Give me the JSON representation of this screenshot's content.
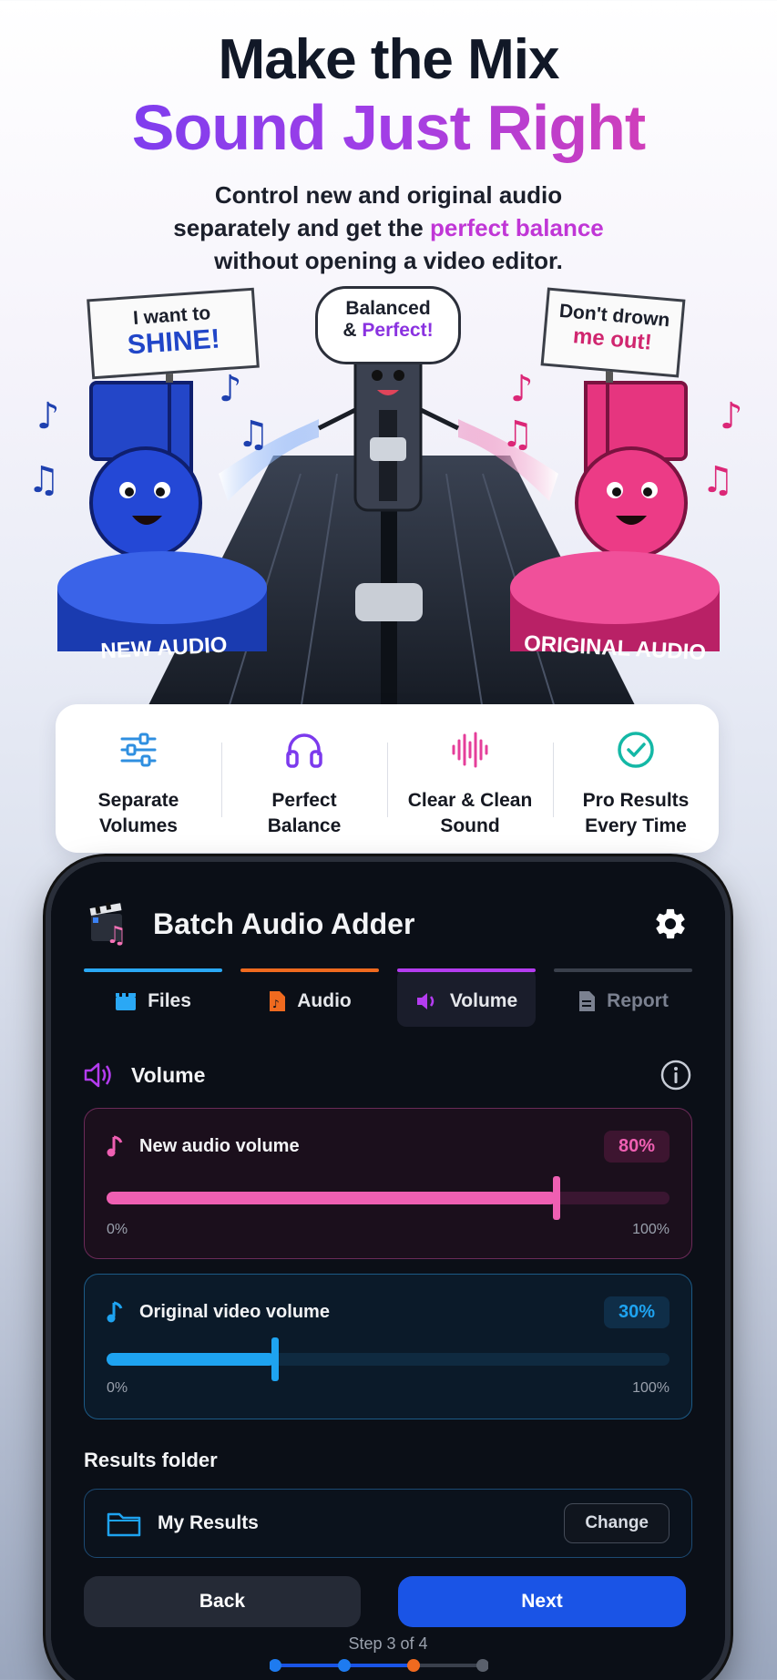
{
  "hero": {
    "headline_line1": "Make the Mix",
    "headline_line2": "Sound Just Right",
    "sub_line1": "Control new and original audio",
    "sub_line2_pre": "separately and get the ",
    "sub_line2_accent": "perfect balance",
    "sub_line3": "without opening a video editor.",
    "left_sign_line1": "I want to",
    "left_sign_line2": "SHINE!",
    "center_bubble_line1": "Balanced",
    "center_bubble_line2_pre": "& ",
    "center_bubble_line2_accent": "Perfect!",
    "right_sign_line1": "Don't drown",
    "right_sign_line2": "me out!",
    "left_pedestal_label": "NEW AUDIO",
    "right_pedestal_label": "ORIGINAL AUDIO"
  },
  "features": [
    {
      "label": "Separate\nVolumes",
      "icon": "sliders-icon",
      "color": "#2f8fe0"
    },
    {
      "label": "Perfect\nBalance",
      "icon": "headphones-icon",
      "color": "#7c3aed"
    },
    {
      "label": "Clear & Clean\nSound",
      "icon": "waveform-icon",
      "color": "#e53e9a"
    },
    {
      "label": "Pro Results\nEvery Time",
      "icon": "check-circle-icon",
      "color": "#14b8a6"
    }
  ],
  "app": {
    "title": "Batch Audio Adder",
    "tabs": [
      {
        "label": "Files",
        "icon": "clapper-icon",
        "color": "#2aa8f5"
      },
      {
        "label": "Audio",
        "icon": "music-file-icon",
        "color": "#f06a1f"
      },
      {
        "label": "Volume",
        "icon": "speaker-icon",
        "color": "#b43cf0"
      },
      {
        "label": "Report",
        "icon": "report-icon",
        "color": "#3a404c"
      }
    ],
    "active_tab": "Volume",
    "section_title": "Volume",
    "new_audio": {
      "label": "New audio volume",
      "value_text": "80%",
      "value": 0.8,
      "min_label": "0%",
      "max_label": "100%",
      "color": "#ef5fb2"
    },
    "original_audio": {
      "label": "Original video volume",
      "value_text": "30%",
      "value": 0.3,
      "min_label": "0%",
      "max_label": "100%",
      "color": "#1ea3f0"
    },
    "results_title": "Results folder",
    "folder_name": "My Results",
    "change_label": "Change",
    "back_label": "Back",
    "next_label": "Next",
    "step_text": "Step 3 of 4",
    "current_step": 3,
    "total_steps": 4
  }
}
